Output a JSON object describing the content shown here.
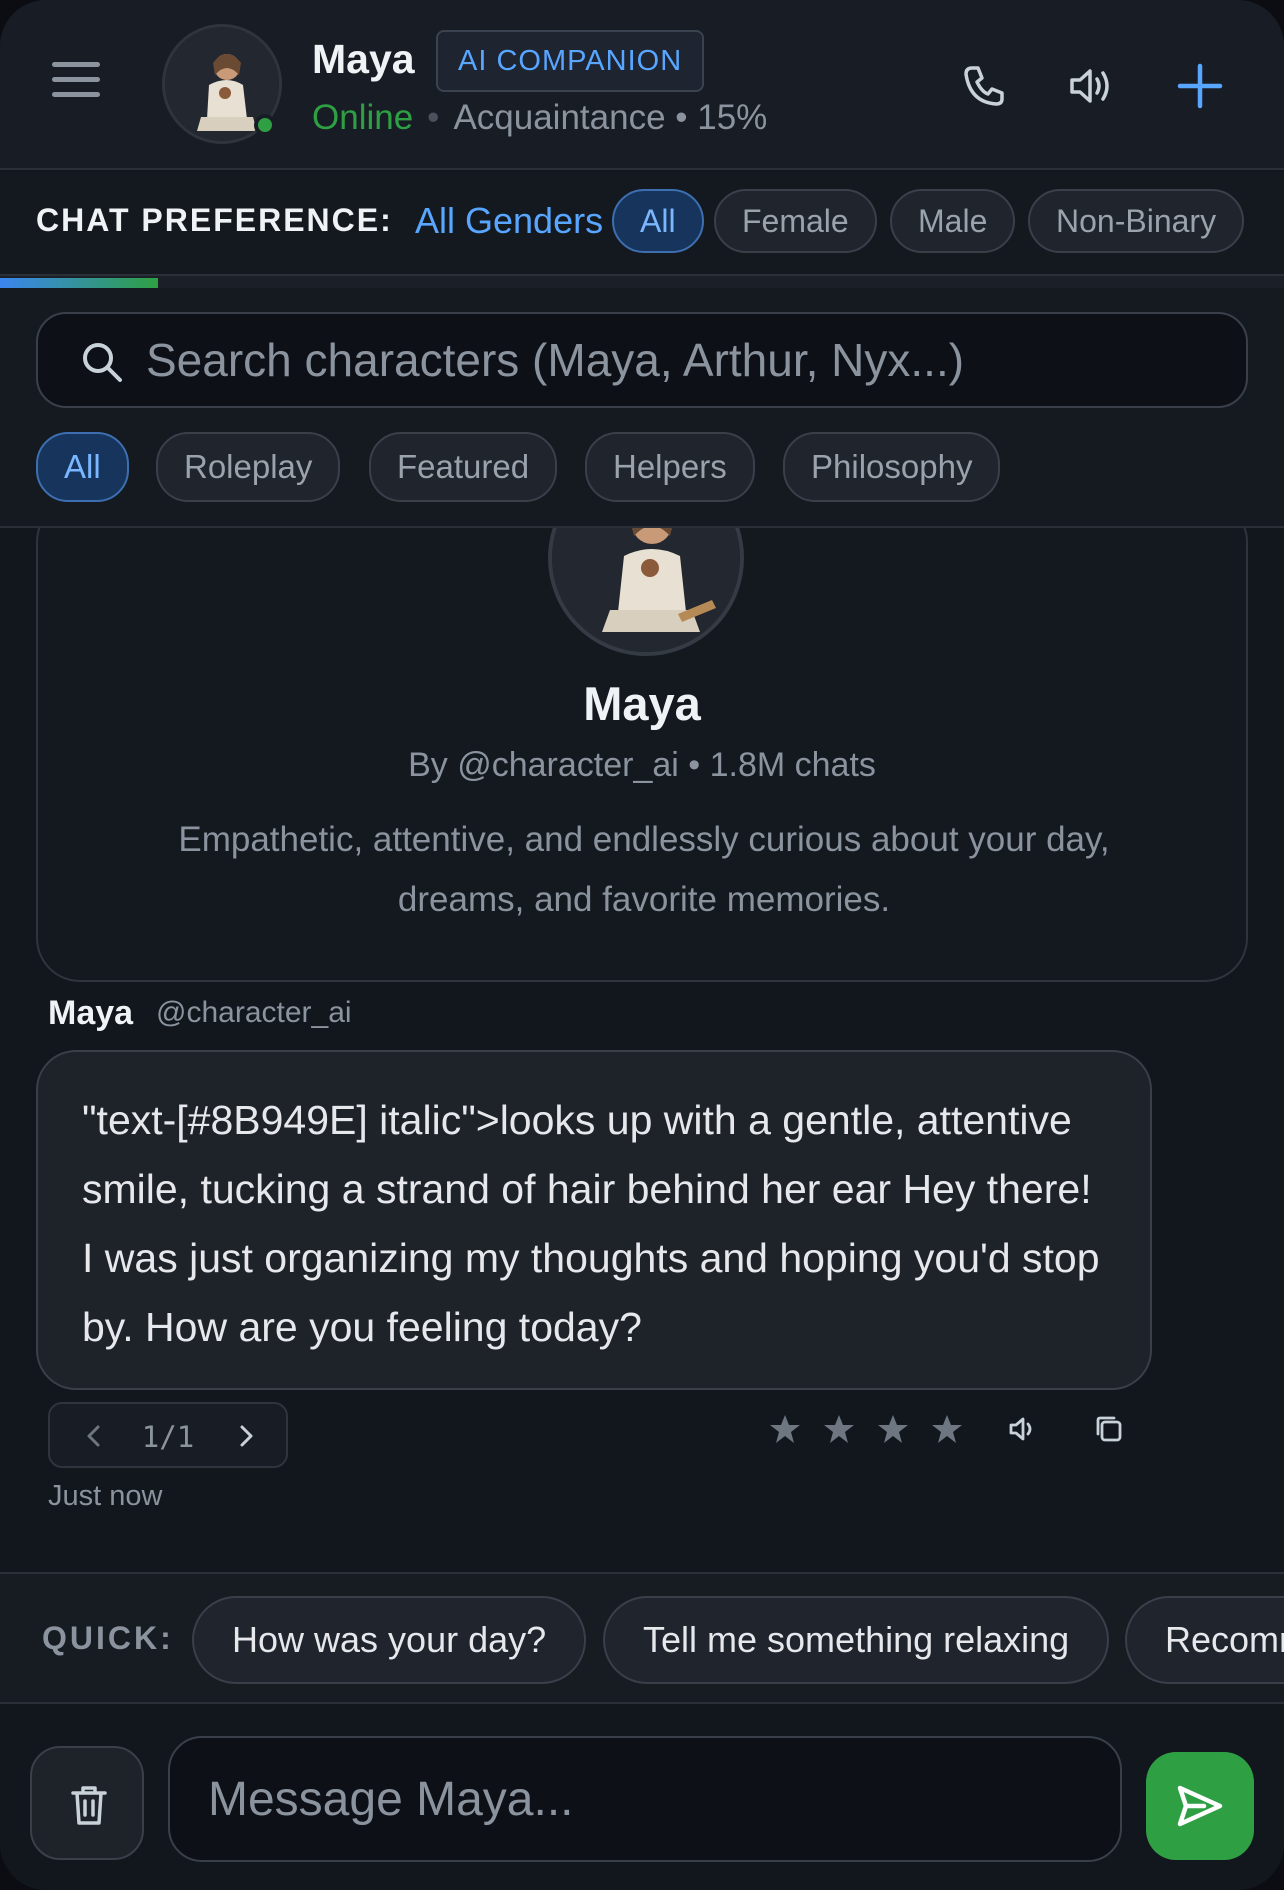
{
  "header": {
    "name": "Maya",
    "badge": "AI COMPANION",
    "status": "Online",
    "relationship": "Acquaintance • 15%"
  },
  "preference": {
    "label": "CHAT PREFERENCE:",
    "value": "All Genders",
    "options": [
      "All",
      "Female",
      "Male",
      "Non-Binary"
    ],
    "selected": "All"
  },
  "relationship_progress": 0.15,
  "search": {
    "placeholder": "Search characters (Maya, Arthur, Nyx...)"
  },
  "categories": {
    "items": [
      "All",
      "Roleplay",
      "Featured",
      "Helpers",
      "Philosophy"
    ],
    "selected": "All"
  },
  "profile": {
    "name": "Maya",
    "meta": "By @character_ai • 1.8M chats",
    "description": "Empathetic, attentive, and endlessly curious about your day, dreams, and favorite memories."
  },
  "message": {
    "author": "Maya",
    "handle": "@character_ai",
    "text": "\"text-[#8B949E] italic\">looks up with a gentle, attentive smile, tucking a strand of hair behind her ear Hey there! I was just organizing my thoughts and hoping you'd stop by. How are you feeling today?",
    "pager": "1/1",
    "timestamp": "Just now",
    "rating_stars": 4
  },
  "quick": {
    "label": "QUICK:",
    "suggestions": [
      "How was your day?",
      "Tell me something relaxing",
      "Recomm"
    ]
  },
  "composer": {
    "placeholder": "Message Maya..."
  },
  "colors": {
    "accent_blue": "#58a6ff",
    "online_green": "#2ea043",
    "muted_text": "#8b949e",
    "background": "#12161d"
  },
  "icons": [
    "menu-icon",
    "phone-icon",
    "speaker-icon",
    "plus-icon",
    "search-icon",
    "chevron-left-icon",
    "chevron-right-icon",
    "star-icon",
    "copy-icon",
    "trash-icon",
    "send-icon"
  ]
}
